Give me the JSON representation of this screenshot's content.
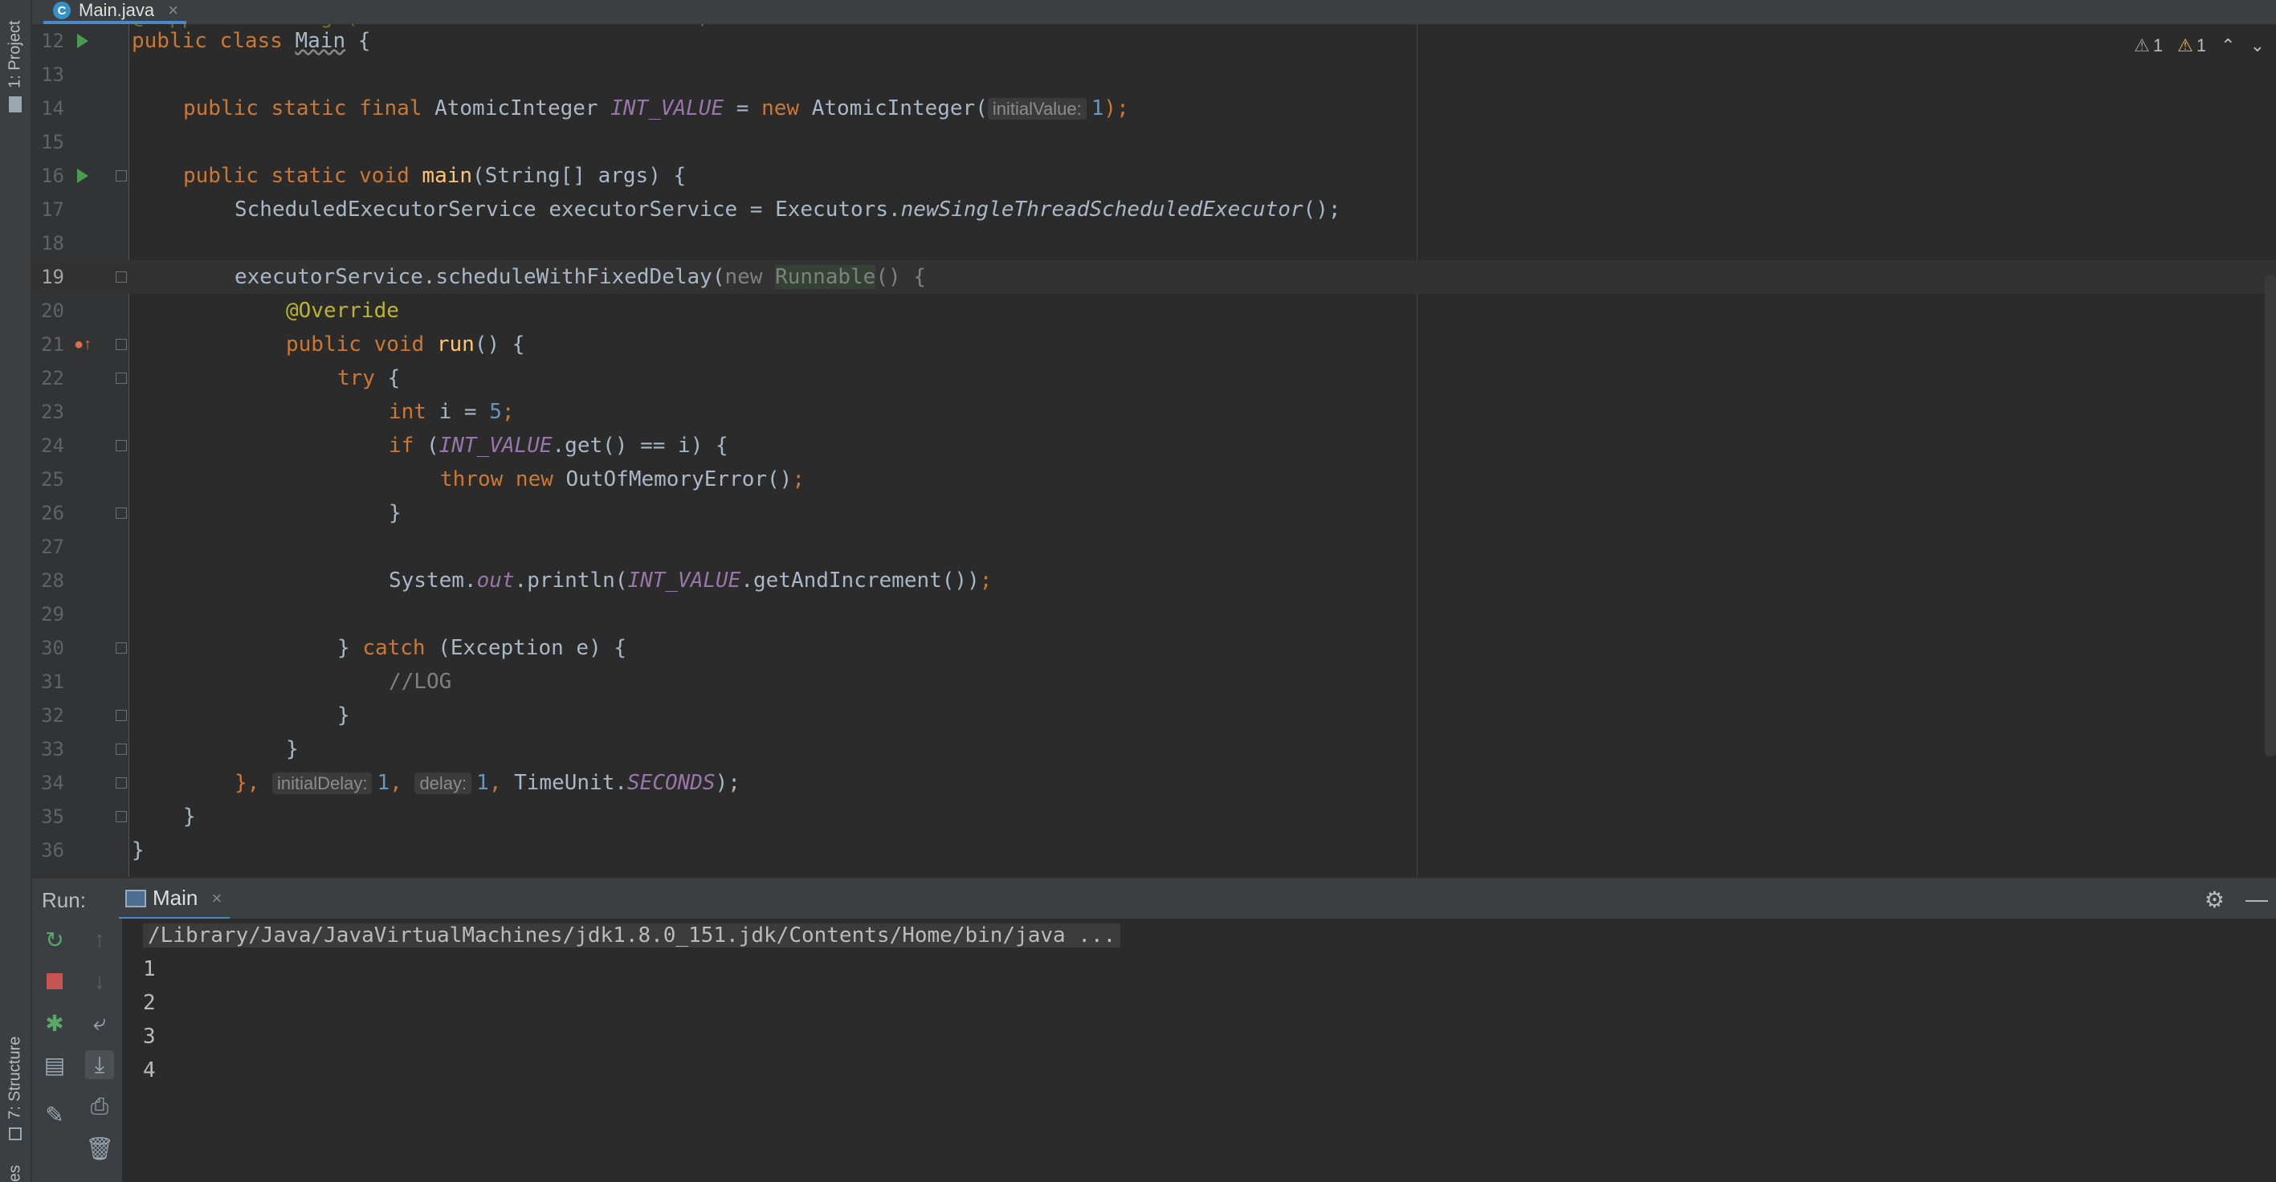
{
  "left_strip": {
    "project_label": "1: Project",
    "structure_label": "7: Structure",
    "favorites_label": "es"
  },
  "tab": {
    "file_name": "Main.java",
    "file_icon_letter": "C"
  },
  "editor": {
    "warnings": {
      "weak_warnings": "1",
      "warnings": "1"
    },
    "partial_top_line": "@SuppressWarnings(\"AlibabaThreadPoolCreation\")",
    "lines": [
      {
        "n": "12"
      },
      {
        "n": "13"
      },
      {
        "n": "14"
      },
      {
        "n": "15"
      },
      {
        "n": "16"
      },
      {
        "n": "17"
      },
      {
        "n": "18"
      },
      {
        "n": "19"
      },
      {
        "n": "20"
      },
      {
        "n": "21"
      },
      {
        "n": "22"
      },
      {
        "n": "23"
      },
      {
        "n": "24"
      },
      {
        "n": "25"
      },
      {
        "n": "26"
      },
      {
        "n": "27"
      },
      {
        "n": "28"
      },
      {
        "n": "29"
      },
      {
        "n": "30"
      },
      {
        "n": "31"
      },
      {
        "n": "32"
      },
      {
        "n": "33"
      },
      {
        "n": "34"
      },
      {
        "n": "35"
      },
      {
        "n": "36"
      }
    ],
    "code": {
      "l12_kw": "public class ",
      "l12_name": "Main",
      "l12_rest": " {",
      "l14_kw": "public static final ",
      "l14_type": "AtomicInteger ",
      "l14_field": "INT_VALUE",
      "l14_eq": " = ",
      "l14_new": "new ",
      "l14_ctor": "AtomicInteger(",
      "l14_hint": "initialValue:",
      "l14_val": "1",
      "l14_end": ");",
      "l16_kw": "public static void ",
      "l16_fn": "main",
      "l16_rest": "(String[] args) {",
      "l17_a": "ScheduledExecutorService executorService = Executors.",
      "l17_m": "newSingleThreadScheduledExecutor",
      "l17_b": "();",
      "l19_a": "executorService.scheduleWithFixedDelay(",
      "l19_new": "new ",
      "l19_r": "Runnable",
      "l19_b": "() {",
      "l20": "@Override",
      "l21_kw": "public void ",
      "l21_fn": "run",
      "l21_rest": "() {",
      "l22_kw": "try",
      "l22_rest": " {",
      "l23_kw": "int ",
      "l23_a": "i = ",
      "l23_num": "5",
      "l23_end": ";",
      "l24_kw": "if ",
      "l24_a": "(",
      "l24_f": "INT_VALUE",
      "l24_b": ".get() == i) {",
      "l25_kw": "throw new ",
      "l25_a": "OutOfMemoryError()",
      "l25_end": ";",
      "l26": "}",
      "l28_a": "System.",
      "l28_out": "out",
      "l28_b": ".println(",
      "l28_f": "INT_VALUE",
      "l28_c": ".getAndIncrement())",
      "l28_end": ";",
      "l30_a": "} ",
      "l30_kw": "catch ",
      "l30_b": "(Exception e) {",
      "l31": "//LOG",
      "l32": "}",
      "l33": "}",
      "l34_a": "}, ",
      "l34_h1": "initialDelay:",
      "l34_v1": "1",
      "l34_c1": ", ",
      "l34_h2": "delay:",
      "l34_v2": "1",
      "l34_c2": ", ",
      "l34_b": "TimeUnit.",
      "l34_f": "SECONDS",
      "l34_end": ");",
      "l35": "}",
      "l36": "}"
    }
  },
  "run_panel": {
    "title": "Run:",
    "tab_label": "Main",
    "command": "/Library/Java/JavaVirtualMachines/jdk1.8.0_151.jdk/Contents/Home/bin/java ...",
    "output": [
      "1",
      "2",
      "3",
      "4"
    ]
  },
  "colors": {
    "keyword": "#cc7832",
    "field": "#9876aa",
    "number": "#6897bb",
    "annotation": "#bbb529",
    "method": "#ffc66d",
    "accent": "#4a88c7"
  }
}
